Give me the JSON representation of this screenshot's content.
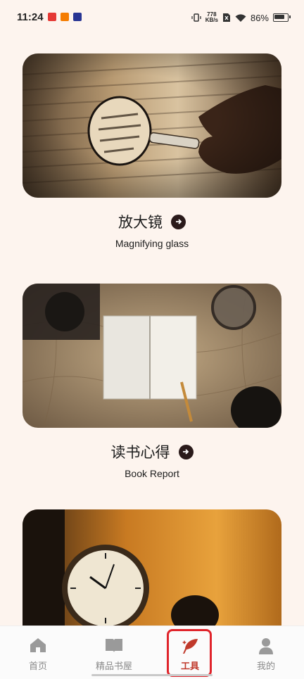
{
  "status_bar": {
    "time": "11:24",
    "network_speed_value": "778",
    "network_speed_unit": "KB/s",
    "battery": "86%"
  },
  "cards": [
    {
      "title": "放大镜",
      "subtitle": "Magnifying glass"
    },
    {
      "title": "读书心得",
      "subtitle": "Book Report"
    }
  ],
  "nav": {
    "items": [
      {
        "label": "首页",
        "icon": "home-icon"
      },
      {
        "label": "精品书屋",
        "icon": "book-icon"
      },
      {
        "label": "工具",
        "icon": "feather-icon"
      },
      {
        "label": "我的",
        "icon": "person-icon"
      }
    ],
    "active_index": 2,
    "active_color": "#c0392b",
    "inactive_color": "#8a8a8a"
  }
}
